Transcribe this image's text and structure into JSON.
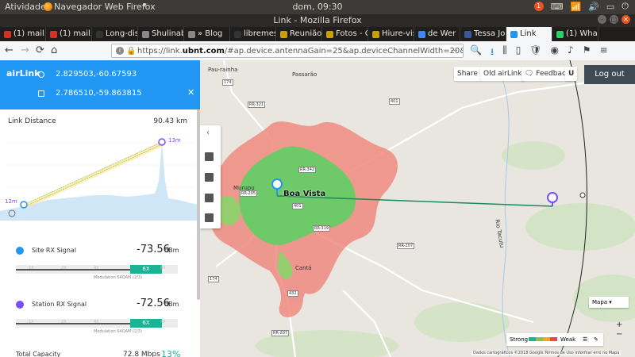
{
  "topbar": {
    "activities": "Atividades",
    "app_name": "Navegador Web Firefox",
    "clock": "dom, 09:30",
    "notification_count": "1"
  },
  "window": {
    "title": "Link - Mozilla Firefox"
  },
  "tabs": [
    {
      "label": "(1) mail.",
      "color": "#d93025"
    },
    {
      "label": "(1) mail.",
      "color": "#d93025"
    },
    {
      "label": "Long-dis",
      "color": "#333333"
    },
    {
      "label": "Shulinab vill",
      "color": "#888888"
    },
    {
      "label": "» Blog",
      "color": "#888888"
    },
    {
      "label": "libremes",
      "color": "#333333"
    },
    {
      "label": "Reunião",
      "color": "#c8a000"
    },
    {
      "label": "Fotos - G",
      "color": "#c8a000"
    },
    {
      "label": "Hiure-vis",
      "color": "#c8a000"
    },
    {
      "label": "de Wer",
      "color": "#4285f4"
    },
    {
      "label": "Tessa Jo",
      "color": "#3b5998"
    },
    {
      "label": "Link",
      "color": "#2196f3",
      "active": true
    },
    {
      "label": "(1) Wha",
      "color": "#25d366"
    }
  ],
  "navbar": {
    "url_prefix": "https://link.",
    "url_domain": "ubnt.com",
    "url_rest": "/#ap.device.antennaGain=25&ap.deviceChannelWidth=20&ap.device"
  },
  "panel": {
    "logo": "airLink",
    "coord_a": "2.829503,-60.67593",
    "coord_b": "2.786510,-59.863815",
    "link_distance_label": "Link Distance",
    "link_distance_value": "90.43 km",
    "alt_left": "12m",
    "alt_right": "13m",
    "site_rx": {
      "name": "Site RX Signal",
      "value": "-73.56",
      "unit": "dBm",
      "modulation": "Modulation 64QAM (2/3)",
      "level": "6X",
      "ticks": [
        "1X",
        "2X",
        "4X",
        "6X",
        "8X"
      ]
    },
    "station_rx": {
      "name": "Station RX Signal",
      "value": "-72.56",
      "unit": "dBm",
      "modulation": "Modulation 64QAM (2/3)",
      "level": "6X",
      "ticks": [
        "1X",
        "2X",
        "4X",
        "6X",
        "8X"
      ]
    },
    "total_capacity_label": "Total Capacity",
    "total_capacity_value": "72.8 Mbps",
    "total_capacity_pct": "13%"
  },
  "map": {
    "share": "Share",
    "old_airlink": "Old airLink",
    "feedback": "Feedback",
    "logout": "Log out",
    "city": "Boa Vista",
    "places": [
      "Pau-rainha",
      "Passarão",
      "Murupu",
      "Cantá",
      "Rio Tacutu"
    ],
    "roads": [
      "174",
      "401",
      "RR-321",
      "RR-205",
      "RR-342",
      "401",
      "RR-319",
      "RR-207",
      "174",
      "432",
      "RR-207"
    ],
    "map_type": "Mapa",
    "legend_strong": "Strong",
    "legend_weak": "Weak",
    "attribution": "Dados cartográficos ©2018 Google  Termos de Uso  Informar erro no Mapa",
    "legend_colors": [
      "#1ab394",
      "#8bc34a",
      "#f5a623",
      "#e74c3c"
    ]
  }
}
